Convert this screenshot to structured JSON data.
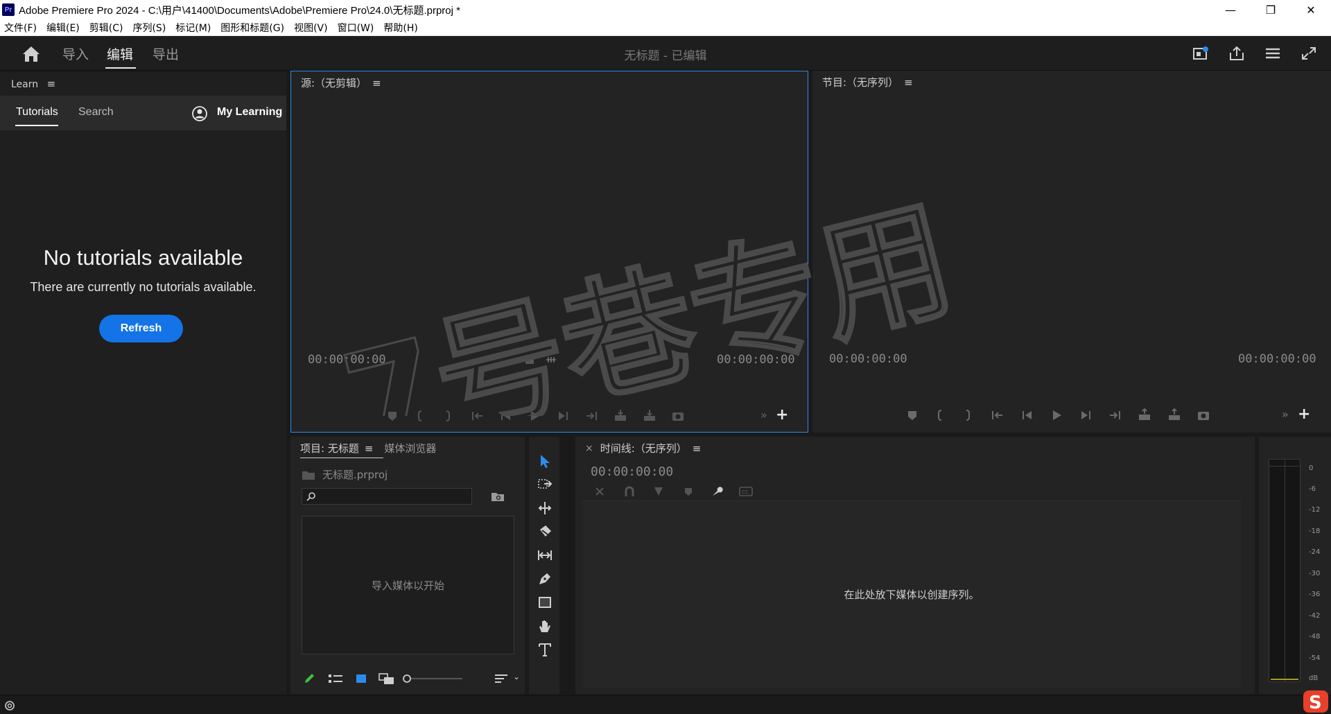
{
  "titlebar": {
    "app_icon": "Pr",
    "title": "Adobe Premiere Pro 2024 - C:\\用户\\41400\\Documents\\Adobe\\Premiere Pro\\24.0\\无标题.prproj *",
    "minimize": "—",
    "restore": "❐",
    "close": "✕"
  },
  "menu": [
    "文件(F)",
    "编辑(E)",
    "剪辑(C)",
    "序列(S)",
    "标记(M)",
    "图形和标题(G)",
    "视图(V)",
    "窗口(W)",
    "帮助(H)"
  ],
  "header": {
    "tabs": [
      "导入",
      "编辑",
      "导出"
    ],
    "active_tab": "编辑",
    "project_title": "无标题 - 已编辑"
  },
  "learn": {
    "panel_title": "Learn",
    "tabs": [
      "Tutorials",
      "Search"
    ],
    "my_learning": "My Learning",
    "empty_title": "No tutorials available",
    "empty_subtitle": "There are currently no tutorials available.",
    "refresh": "Refresh"
  },
  "source": {
    "title": "源:（无剪辑）",
    "timecode_in": "00:00:00:00",
    "timecode_out": "00:00:00:00"
  },
  "program": {
    "title": "节目:（无序列）",
    "timecode_in": "00:00:00:00",
    "timecode_out": "00:00:00:00"
  },
  "project": {
    "tab_project": "项目: 无标题",
    "tab_media": "媒体浏览器",
    "file": "无标题.prproj",
    "drop_hint": "导入媒体以开始"
  },
  "timeline": {
    "close": "×",
    "title": "时间线:（无序列）",
    "timecode": "00:00:00:00",
    "drop_hint": "在此处放下媒体以创建序列。"
  },
  "meter": {
    "labels": [
      "0",
      "-6",
      "-12",
      "-18",
      "-24",
      "-30",
      "-36",
      "-42",
      "-48",
      "-54",
      "dB"
    ]
  },
  "watermark": "7号巷专用",
  "colors": {
    "accent": "#1473e6",
    "panel_bg": "#232323",
    "focus_border": "#2d8ceb"
  }
}
